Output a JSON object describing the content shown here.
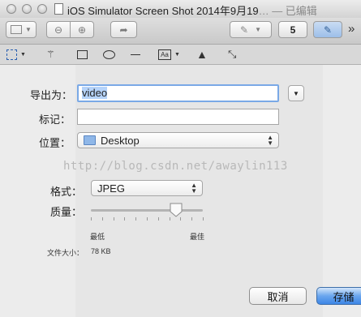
{
  "window": {
    "title": "iOS Simulator Screen Shot 2014年9月19",
    "title_suffix": "… — 已编辑",
    "overflow_glyph": "»"
  },
  "toolbar": {
    "share_glyph": "➦",
    "rotate_glyph": "5",
    "edit_glyph": "✎"
  },
  "form": {
    "export_label": "导出为：",
    "export_value": "video",
    "tags_label": "标记：",
    "tags_value": "",
    "location_label": "位置：",
    "location_value": "Desktop",
    "format_label": "格式：",
    "format_value": "JPEG",
    "quality_label": "质量：",
    "quality_level": 0.76,
    "quality_min": "最低",
    "quality_max": "最佳",
    "filesize_label": "文件大小：",
    "filesize_value": "78 KB"
  },
  "watermark": "http://blog.csdn.net/awaylin113",
  "buttons": {
    "cancel": "取消",
    "save": "存储"
  }
}
